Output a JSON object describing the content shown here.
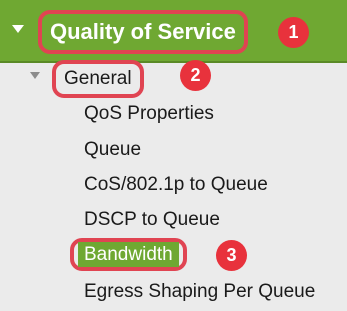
{
  "header": {
    "title": "Quality of Service",
    "badge": "1"
  },
  "general": {
    "label": "General",
    "badge": "2"
  },
  "menu": {
    "items": [
      "QoS Properties",
      "Queue",
      "CoS/802.1p to Queue",
      "DSCP to Queue"
    ],
    "selected": {
      "label": "Bandwidth",
      "badge": "3"
    },
    "last": "Egress Shaping Per Queue"
  },
  "colors": {
    "header_bg": "#6fa832",
    "selected_bg": "#6fa832",
    "highlight_outline": "#e04452",
    "badge": "#e8323c",
    "panel_bg": "#ebebeb"
  }
}
